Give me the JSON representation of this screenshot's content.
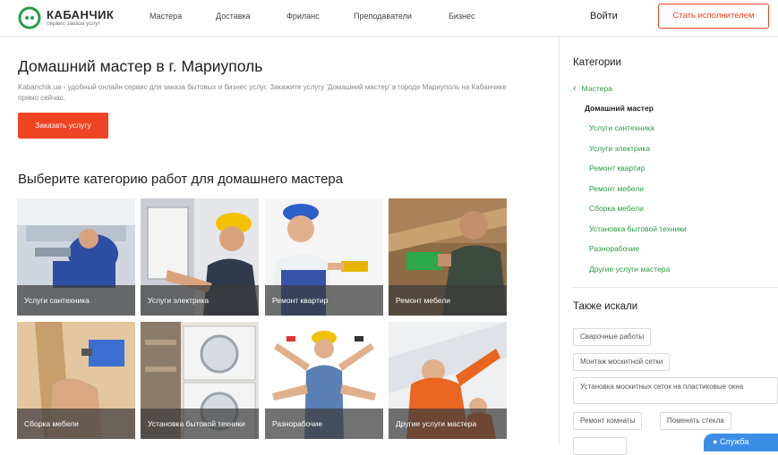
{
  "header": {
    "logo_title": "КАБАНЧИК",
    "logo_subtitle": "сервис заказа услуг",
    "nav": [
      {
        "label": "Мастера"
      },
      {
        "label": "Доставка"
      },
      {
        "label": "Фриланс"
      },
      {
        "label": "Преподаватели"
      },
      {
        "label": "Бизнес"
      }
    ],
    "login_label": "Войти",
    "become_label": "Стать исполнителем"
  },
  "main": {
    "title": "Домашний мастер в г. Мариуполь",
    "description": "Kabanchik.ua - удобный онлайн сервис для заказа бытовых и бизнес услуг. Закажите услугу 'Домашний мастер' в городе Мариуполь на Кабанчике прямо сейчас.",
    "order_label": "Заказать услугу",
    "section_title": "Выберите категорию работ для домашнего мастера",
    "tiles": [
      {
        "label": "Услуги сантехника"
      },
      {
        "label": "Услуги электрика"
      },
      {
        "label": "Ремонт квартир"
      },
      {
        "label": "Ремонт мебели"
      },
      {
        "label": "Сборка мебели"
      },
      {
        "label": "Установка бытовой техники"
      },
      {
        "label": "Разнорабочие"
      },
      {
        "label": "Другие услуги мастера"
      }
    ]
  },
  "sidebar": {
    "title": "Категории",
    "back_label": "Мастера",
    "current": "Домашний мастер",
    "links": [
      {
        "label": "Услуги сантехника"
      },
      {
        "label": "Услуги электрика"
      },
      {
        "label": "Ремонт квартир"
      },
      {
        "label": "Ремонт мебели"
      },
      {
        "label": "Сборка мебели"
      },
      {
        "label": "Установка бытовой техники"
      },
      {
        "label": "Разнорабочие"
      },
      {
        "label": "Другие услуги мастера"
      }
    ],
    "also_title": "Также искали",
    "also": [
      {
        "label": "Сварочные работы"
      },
      {
        "label": "Монтаж москитной сетки"
      },
      {
        "label": "Установка москитных сеток на пластиковые окна"
      },
      {
        "label": "Ремонт комнаты"
      },
      {
        "label": "Поменять стекла"
      }
    ]
  },
  "support_label": "Служба",
  "colors": {
    "accent": "#ef4423",
    "link": "#2a9d49",
    "support": "#3a8ee6"
  },
  "icons": [
    "logo-piglet-icon",
    "chevron-left-icon",
    "chat-icon"
  ]
}
